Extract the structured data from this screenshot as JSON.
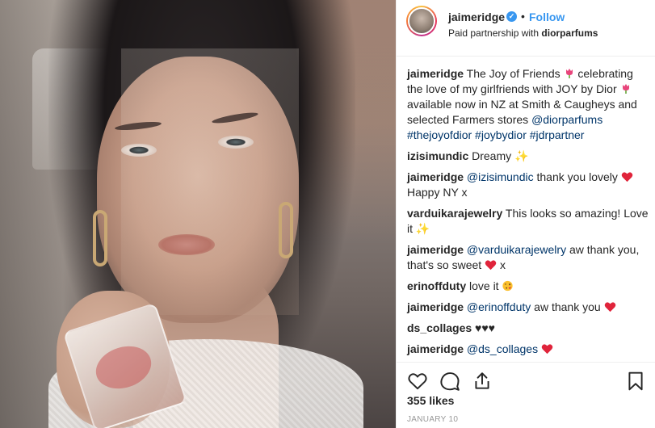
{
  "post": {
    "image_alt": "Woman holding a JOY by Dior perfume bottle",
    "header": {
      "username": "jaimeridge",
      "verified_icon": "verified-badge-icon",
      "separator": "•",
      "follow_label": "Follow",
      "partnership_prefix": "Paid partnership with ",
      "partner_name": "diorparfums"
    },
    "caption": {
      "username": "jaimeridge",
      "text_1": " The Joy of Friends ",
      "text_2": " celebrating the love of my girlfriends with JOY by Dior ",
      "text_3": " available now in NZ at Smith & Caugheys and selected Farmers stores ",
      "mention": "@diorparfums",
      "hashtags": "#thejoyofdior #joybydior #jdrpartner"
    },
    "comments": [
      {
        "username": "izisimundic",
        "text": " Dreamy ",
        "emoji": "sparkles"
      },
      {
        "username": "jaimeridge",
        "mention": "@izisimundic",
        "text": " thank you lovely ",
        "text_after": "Happy NY x",
        "emoji": "heart"
      },
      {
        "username": "varduikarajewelry",
        "text": " This looks so amazing! Love it ",
        "emoji": "sparkles"
      },
      {
        "username": "jaimeridge",
        "mention": "@varduikarajewelry",
        "text": " aw thank you, that's so sweet ",
        "text_after": " x",
        "emoji": "heart"
      },
      {
        "username": "erinoffduty",
        "text": " love it ",
        "emoji": "blowing-kiss"
      },
      {
        "username": "jaimeridge",
        "mention": "@erinoffduty",
        "text": " aw thank you ",
        "emoji": "heart"
      },
      {
        "username": "ds_collages",
        "text": " ♥♥♥"
      },
      {
        "username": "jaimeridge",
        "mention": "@ds_collages",
        "text": " ",
        "emoji": "heart"
      }
    ],
    "actions": {
      "like_icon": "heart-outline-icon",
      "comment_icon": "comment-icon",
      "share_icon": "share-icon",
      "save_icon": "bookmark-icon"
    },
    "likes": "355 likes",
    "date": "JANUARY 10"
  },
  "colors": {
    "link": "#003569",
    "follow": "#3897f0",
    "heart": "#ed4956",
    "border": "#efefef"
  }
}
